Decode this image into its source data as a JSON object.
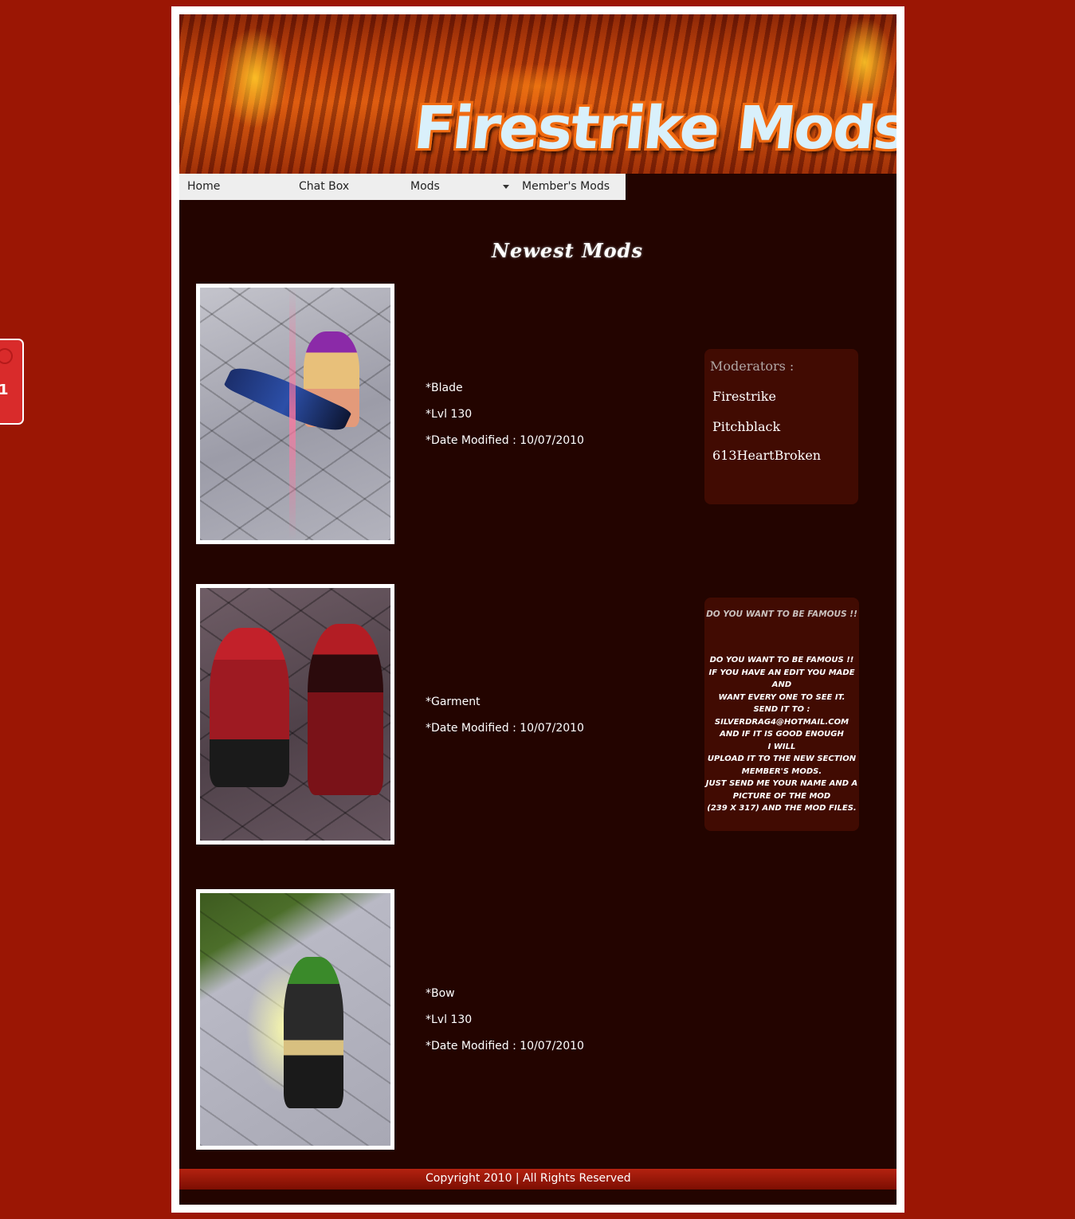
{
  "site": {
    "title": "Firestrike Mods"
  },
  "side_tab": {
    "label": "1"
  },
  "nav": {
    "items": [
      {
        "label": "Home"
      },
      {
        "label": "Chat Box"
      },
      {
        "label": "Mods",
        "has_dropdown": true
      },
      {
        "label": "Member's Mods"
      }
    ]
  },
  "main": {
    "section_title": "Newest Mods",
    "mods": [
      {
        "lines": [
          "*Blade",
          "*Lvl 130",
          "*Date Modified : 10/07/2010"
        ]
      },
      {
        "lines": [
          "*Garment",
          "*Date Modified : 10/07/2010"
        ]
      },
      {
        "lines": [
          "*Bow",
          "*Lvl 130",
          "*Date Modified : 10/07/2010"
        ]
      }
    ]
  },
  "moderators": {
    "header": "Moderators :",
    "names": [
      "Firestrike",
      "Pitchblack",
      "613HeartBroken"
    ]
  },
  "famous": {
    "header": "Do you want to be famous !!",
    "body": "Do you want to be famous !!\nIf you have an edit you made and\nwant every one to see it.\nSend it to :\nsilverdrag4@hotmail.com\nand if it is good enough\nI will\nupload it to the new section\nMember's Mods.\nJust send me your name and a\npicture of the mod\n(239 x 317) and the mod files."
  },
  "footer": {
    "text": "Copyright 2010 | All Rights Reserved"
  },
  "colors": {
    "page_bg": "#9b1604",
    "content_bg": "#230400",
    "box_bg": "#410b02",
    "nav_bg": "#eeeeee"
  }
}
